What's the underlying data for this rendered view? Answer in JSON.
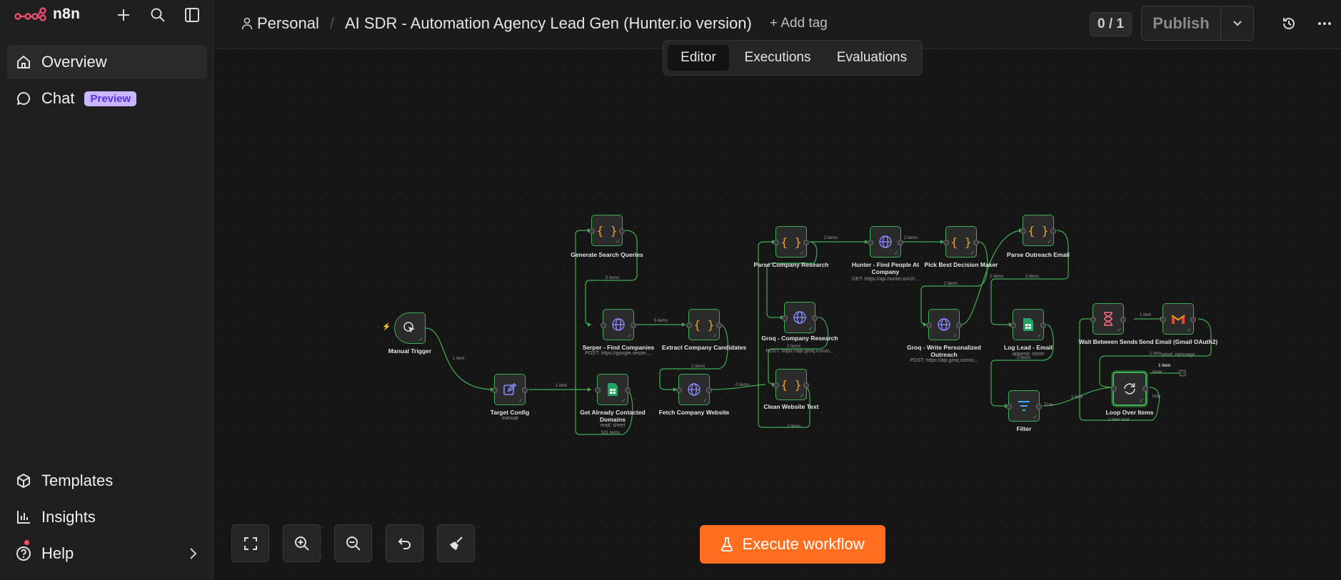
{
  "app": {
    "name": "n8n"
  },
  "sidebar": {
    "nav": [
      {
        "label": "Overview"
      },
      {
        "label": "Chat",
        "badge": "Preview"
      }
    ],
    "bottom": [
      {
        "label": "Templates"
      },
      {
        "label": "Insights"
      },
      {
        "label": "Help"
      }
    ]
  },
  "header": {
    "project": "Personal",
    "separator": "/",
    "workflow_name": "AI SDR - Automation Agency Lead Gen (Hunter.io version)",
    "add_tag": "+ Add tag",
    "counter": "0 / 1",
    "publish": "Publish",
    "tabs": [
      "Editor",
      "Executions",
      "Evaluations"
    ],
    "active_tab": "Editor"
  },
  "canvas": {
    "nodes": {
      "manual_trigger": {
        "label": "Manual Trigger"
      },
      "target_config": {
        "label": "Target Config",
        "sub": "manual"
      },
      "generate_queries": {
        "label": "Generate Search Queries"
      },
      "serper": {
        "label": "Serper - Find Companies",
        "sub": "POST: https://google.serper...."
      },
      "get_contacted": {
        "label": "Get Already Contacted Domains",
        "sub": "read: sheet"
      },
      "extract_candidates": {
        "label": "Extract Company Candidates"
      },
      "fetch_website": {
        "label": "Fetch Company Website"
      },
      "parse_research": {
        "label": "Parse Company Research"
      },
      "groq_research": {
        "label": "Groq - Company Research",
        "sub": "POST: https://api.groq.com/o..."
      },
      "clean_text": {
        "label": "Clean Website Text"
      },
      "hunter": {
        "label": "Hunter - Find People At Company",
        "sub": "GET: https://api.hunter.io/v2/..."
      },
      "pick_best": {
        "label": "Pick Best Decision Maker"
      },
      "groq_write": {
        "label": "Groq - Write Personalized Outreach",
        "sub": "POST: https://api.groq.com/o..."
      },
      "parse_outreach": {
        "label": "Parse Outreach Email"
      },
      "log_lead": {
        "label": "Log Lead - Email",
        "sub": "append: sheet"
      },
      "filter": {
        "label": "Filter"
      },
      "wait": {
        "label": "Wait Between Sends"
      },
      "send_email": {
        "label": "Send Email (Gmail OAuth2)",
        "sub": "send: message"
      },
      "loop": {
        "label": "Loop Over Items"
      }
    },
    "edge_labels": {
      "trigger_config": "1 item",
      "config_contacted": "1 item",
      "queries_serper": "5 items",
      "serper_extract": "5 items",
      "contacted_count": "531 items",
      "extract_fetch": "2 items",
      "fetch_clean": "2 items",
      "clean_loop": "2 items",
      "research_groq": "2 items",
      "parse_hunter": "2 items",
      "hunter_pick": "2 items",
      "pick_write": "2 items",
      "write_parse": "2 items",
      "outreach_log": "2 items",
      "log_filter": "2 items",
      "filter_true": "True",
      "filter_loop": "1 item",
      "wait_send": "1 item",
      "send_loop": "1 item",
      "loop_done_count": "1 item",
      "loop_done": "done",
      "loop_loop": "loop",
      "loop_total": "1 item total"
    },
    "execute_button": "Execute workflow"
  },
  "colors": {
    "accent": "#ff6d1f",
    "node_border": "#3fae55",
    "edge": "#3fae55",
    "logo": "#ea4b71",
    "badge_bg": "#c9b7ff",
    "badge_text": "#5b2fd4"
  }
}
